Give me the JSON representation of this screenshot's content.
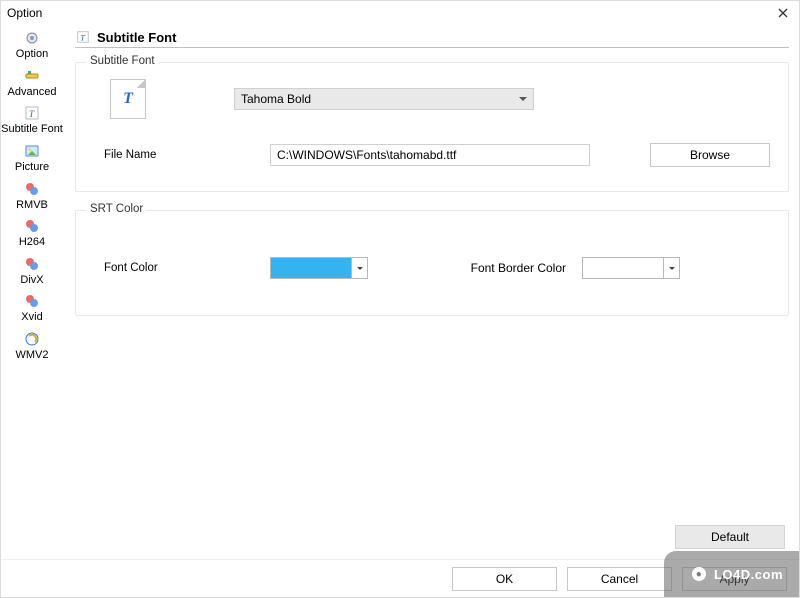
{
  "window": {
    "title": "Option"
  },
  "sidebar": {
    "items": [
      {
        "label": "Option"
      },
      {
        "label": "Advanced"
      },
      {
        "label": "Subtitle Font"
      },
      {
        "label": "Picture"
      },
      {
        "label": "RMVB"
      },
      {
        "label": "H264"
      },
      {
        "label": "DivX"
      },
      {
        "label": "Xvid"
      },
      {
        "label": "WMV2"
      }
    ]
  },
  "page": {
    "title": "Subtitle Font"
  },
  "subtitle_font": {
    "legend": "Subtitle Font",
    "font_name": "Tahoma Bold",
    "file_label": "File Name",
    "file_path": "C:\\WINDOWS\\Fonts\\tahomabd.ttf",
    "browse_label": "Browse"
  },
  "srt_color": {
    "legend": "SRT Color",
    "font_color_label": "Font Color",
    "font_color_value": "#35b3ee",
    "border_color_label": "Font Border Color",
    "border_color_value": "#ffffff"
  },
  "buttons": {
    "default": "Default",
    "ok": "OK",
    "cancel": "Cancel",
    "apply": "Apply"
  },
  "watermark": "LO4D.com"
}
